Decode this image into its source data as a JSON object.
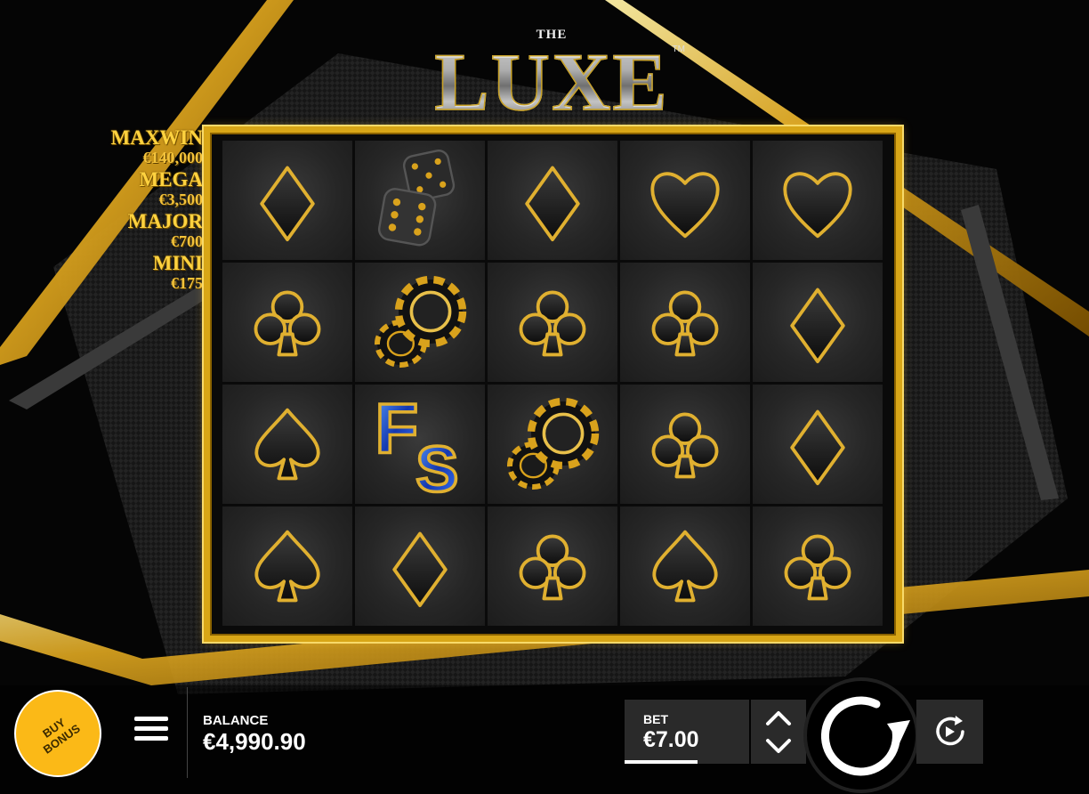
{
  "game": {
    "logo_small": "THE",
    "logo_title": "LUXE",
    "logo_tm": "TM"
  },
  "jackpots": [
    {
      "name": "MAXWIN",
      "amount": "€140,000"
    },
    {
      "name": "MEGA",
      "amount": "€3,500"
    },
    {
      "name": "MAJOR",
      "amount": "€700"
    },
    {
      "name": "MINI",
      "amount": "€175"
    }
  ],
  "reels": [
    [
      "diamond",
      "dice",
      "diamond",
      "heart",
      "heart"
    ],
    [
      "club",
      "chips",
      "club",
      "club",
      "diamond"
    ],
    [
      "spade",
      "freespins",
      "chips",
      "club",
      "diamond"
    ],
    [
      "spade",
      "diamond",
      "club",
      "spade",
      "club"
    ]
  ],
  "freespins_label": "FS",
  "controls": {
    "buy_bonus_label": "BUY BONUS",
    "balance_label": "BALANCE",
    "balance_value": "€4,990.90",
    "bet_label": "BET",
    "bet_value": "€7.00",
    "menu_icon": "hamburger-menu-icon",
    "spin_icon": "spin-icon",
    "autoplay_icon": "autoplay-icon"
  },
  "colors": {
    "gold": "#d8a617",
    "buy_bonus": "#fbb917",
    "panel": "#2a2a2a"
  }
}
